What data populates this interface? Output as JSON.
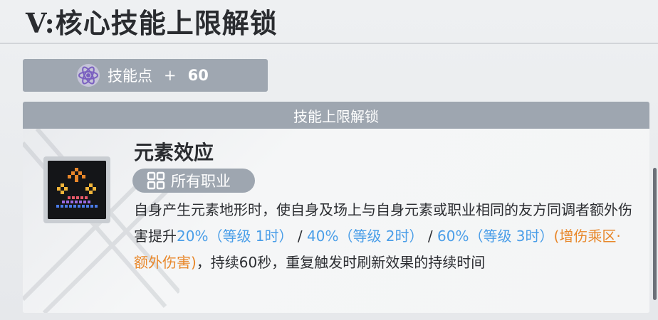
{
  "header": {
    "title": "V:核心技能上限解锁"
  },
  "points": {
    "label": "技能点",
    "plus": "+",
    "value": "60",
    "icon": "atom-icon"
  },
  "panel": {
    "title": "技能上限解锁",
    "skill": {
      "name": "元素效应",
      "tag": "所有职业",
      "desc": {
        "line1": "自身产生元素地形时，使自身及场上与自身元素或职业相同的友方同调者额外伤害提升",
        "lv1": "20%（等级 1时）",
        "sep1": " / ",
        "lv2": "40%（等级 2时）",
        "sep2": " / ",
        "lv3": "60%（等级 3时）",
        "tagtext": "(增伤乘区·额外伤害)",
        "tail": "，持续60秒，重复触发时刷新效果的持续时间"
      }
    }
  },
  "colors": {
    "accent_blue": "#4a9ee8",
    "accent_orange": "#e8872a",
    "pill_bg": "#9fa7b1"
  }
}
